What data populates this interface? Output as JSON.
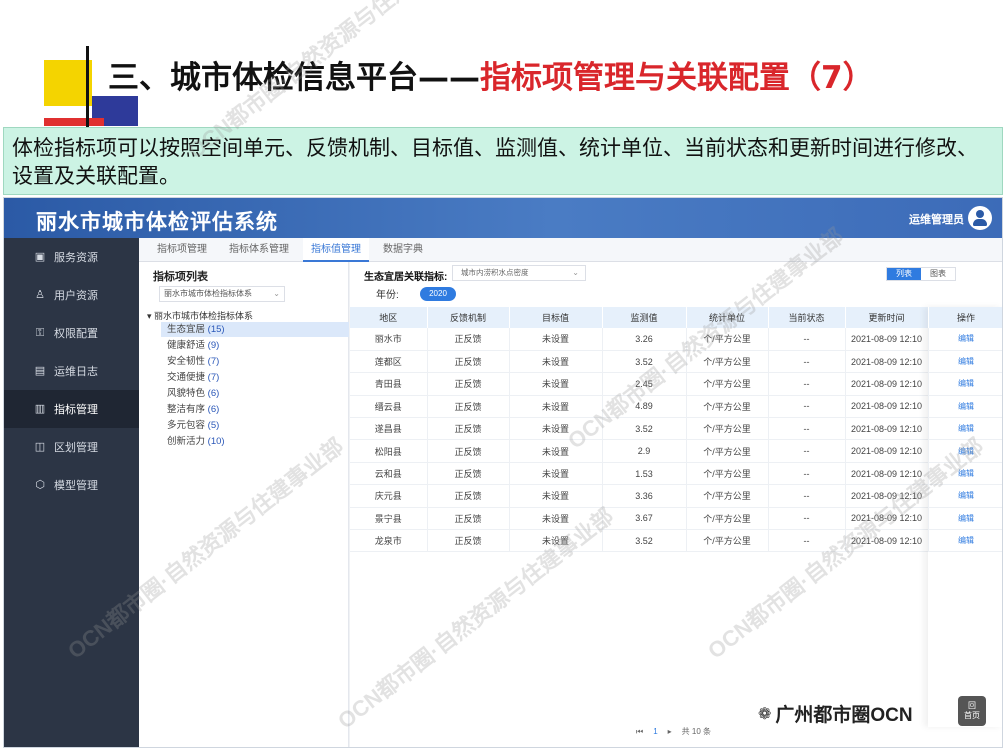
{
  "slide": {
    "title_prefix": "三、城市体检信息平台——",
    "title_highlight": "指标项管理与关联配置（7）",
    "description": "体检指标项可以按照空间单元、反馈机制、目标值、监测值、统计单位、当前状态和更新时间进行修改、设置及关联配置。"
  },
  "app": {
    "system_title": "丽水市城市体检评估系统",
    "user_name": "运维管理员"
  },
  "sidebar": {
    "items": [
      {
        "label": "服务资源",
        "icon": "server-icon"
      },
      {
        "label": "用户资源",
        "icon": "user-icon"
      },
      {
        "label": "权限配置",
        "icon": "key-icon"
      },
      {
        "label": "运维日志",
        "icon": "log-icon"
      },
      {
        "label": "指标管理",
        "icon": "chart-icon"
      },
      {
        "label": "区划管理",
        "icon": "map-icon"
      },
      {
        "label": "模型管理",
        "icon": "cube-icon"
      }
    ],
    "active_index": 4
  },
  "tabs": [
    "指标项管理",
    "指标体系管理",
    "指标值管理",
    "数据字典"
  ],
  "tree": {
    "heading": "指标项列表",
    "system_select": "丽水市城市体检指标体系",
    "root": "丽水市城市体检指标体系",
    "nodes": [
      {
        "label": "生态宜居",
        "count": "(15)"
      },
      {
        "label": "健康舒适",
        "count": "(9)"
      },
      {
        "label": "安全韧性",
        "count": "(7)"
      },
      {
        "label": "交通便捷",
        "count": "(7)"
      },
      {
        "label": "风貌特色",
        "count": "(6)"
      },
      {
        "label": "整洁有序",
        "count": "(6)"
      },
      {
        "label": "多元包容",
        "count": "(5)"
      },
      {
        "label": "创新活力",
        "count": "(10)"
      }
    ]
  },
  "main": {
    "filter_label": "生态宜居关联指标:",
    "filter_value": "城市内涝积水点密度",
    "view_list": "列表",
    "view_chart": "图表",
    "year_label": "年份:",
    "year_value": "2020",
    "columns": [
      "地区",
      "反馈机制",
      "目标值",
      "监测值",
      "统计单位",
      "当前状态",
      "更新时间",
      "操作"
    ],
    "rows": [
      [
        "丽水市",
        "正反馈",
        "未设置",
        "3.26",
        "个/平方公里",
        "--",
        "2021-08-09 12:10",
        "编辑"
      ],
      [
        "莲都区",
        "正反馈",
        "未设置",
        "3.52",
        "个/平方公里",
        "--",
        "2021-08-09 12:10",
        "编辑"
      ],
      [
        "青田县",
        "正反馈",
        "未设置",
        "2.45",
        "个/平方公里",
        "--",
        "2021-08-09 12:10",
        "编辑"
      ],
      [
        "缙云县",
        "正反馈",
        "未设置",
        "4.89",
        "个/平方公里",
        "--",
        "2021-08-09 12:10",
        "编辑"
      ],
      [
        "遂昌县",
        "正反馈",
        "未设置",
        "3.52",
        "个/平方公里",
        "--",
        "2021-08-09 12:10",
        "编辑"
      ],
      [
        "松阳县",
        "正反馈",
        "未设置",
        "2.9",
        "个/平方公里",
        "--",
        "2021-08-09 12:10",
        "编辑"
      ],
      [
        "云和县",
        "正反馈",
        "未设置",
        "1.53",
        "个/平方公里",
        "--",
        "2021-08-09 12:10",
        "编辑"
      ],
      [
        "庆元县",
        "正反馈",
        "未设置",
        "3.36",
        "个/平方公里",
        "--",
        "2021-08-09 12:10",
        "编辑"
      ],
      [
        "景宁县",
        "正反馈",
        "未设置",
        "3.67",
        "个/平方公里",
        "--",
        "2021-08-09 12:10",
        "编辑"
      ],
      [
        "龙泉市",
        "正反馈",
        "未设置",
        "3.52",
        "个/平方公里",
        "--",
        "2021-08-09 12:10",
        "编辑"
      ]
    ],
    "pager": {
      "current": "1",
      "total": "共 10 条"
    }
  },
  "footer": {
    "brand": "广州都市圈OCN",
    "home_line1": "回",
    "home_line2": "首页"
  },
  "watermark": "OCN都市圈·自然资源与住建事业部",
  "colors": {
    "title_highlight": "#d9262b",
    "accent": "#2f7be0",
    "sidebar": "#2c3545",
    "desc_bg": "#ccf3e4"
  }
}
